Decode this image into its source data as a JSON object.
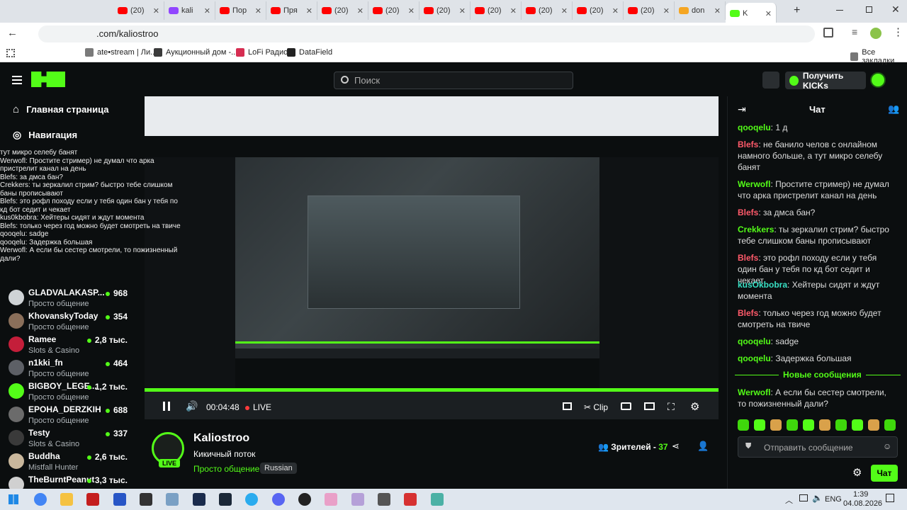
{
  "browser": {
    "tabs": [
      {
        "label": "(20)",
        "color": "#ff0000"
      },
      {
        "label": "kali",
        "color": "#9146ff"
      },
      {
        "label": "Пор",
        "color": "#ff0000"
      },
      {
        "label": "Пря",
        "color": "#ff0000"
      },
      {
        "label": "(20)",
        "color": "#ff0000"
      },
      {
        "label": "(20)",
        "color": "#ff0000"
      },
      {
        "label": "(20)",
        "color": "#ff0000"
      },
      {
        "label": "(20)",
        "color": "#ff0000"
      },
      {
        "label": "(20)",
        "color": "#ff0000"
      },
      {
        "label": "(20)",
        "color": "#ff0000"
      },
      {
        "label": "(20)",
        "color": "#ff0000"
      },
      {
        "label": "don",
        "color": "#f5a623"
      },
      {
        "label": "K",
        "color": "#53fc18"
      }
    ],
    "new_tab": "+",
    "url": ".com/kaliostroo",
    "bookmarks": [
      {
        "label": "ate•stream | Ли...",
        "color": "#7a7a7a"
      },
      {
        "label": "Аукционный дом -...",
        "color": "#3b3b3b"
      },
      {
        "label": "LoFi Радио",
        "color": "#d62d51"
      },
      {
        "label": "DataField",
        "color": "#222"
      }
    ],
    "all_bookmarks": "Все закладки"
  },
  "header": {
    "search_placeholder": "Поиск",
    "get_kicks": "Получить KICKs"
  },
  "sidebar": {
    "nav": [
      {
        "label": "Главная страница",
        "icon": "home-icon"
      },
      {
        "label": "Навигация",
        "icon": "compass-icon"
      }
    ],
    "channels": [
      {
        "name": "GLADVALAKASP...",
        "category": "Просто общение",
        "viewers": "968",
        "avatar": "#cfd3d6"
      },
      {
        "name": "KhovanskyToday",
        "category": "Просто общение",
        "viewers": "354",
        "avatar": "#8a6f5a"
      },
      {
        "name": "Ramee",
        "category": "Slots & Casino",
        "viewers": "2,8 тыс.",
        "avatar": "#c41e3a"
      },
      {
        "name": "n1kki_fn",
        "category": "Просто общение",
        "viewers": "464",
        "avatar": "#5d6066"
      },
      {
        "name": "BIGBOY_LEGE...",
        "category": "Просто общение",
        "viewers": "1,2 тыс.",
        "avatar": "#53fc18"
      },
      {
        "name": "EPOHA_DERZKIH",
        "category": "Просто общение",
        "viewers": "688",
        "avatar": "#6b6b6b"
      },
      {
        "name": "Testy",
        "category": "Slots & Casino",
        "viewers": "337",
        "avatar": "#3a3a3a"
      },
      {
        "name": "Buddha",
        "category": "Mistfall Hunter",
        "viewers": "2,6 тыс.",
        "avatar": "#c9b79c"
      },
      {
        "name": "TheBurntPeanut",
        "category": "",
        "viewers": "3,3 тыс.",
        "avatar": "#d0d0d0"
      }
    ]
  },
  "ghost_overlay": [
    "тут микро селебу банят",
    "Werwofl: Простите стример) не думал что арка",
    "пристрелит канал на день",
    "Blefs: за дмса бан?",
    "Crekkers: ты зеркалил стрим? быстро тебе слишком",
    "баны прописывают",
    "Blefs: это рофл походу если у тебя один бан у тебя по",
    "кд бот седит и чекает",
    "kus0kbobra: Хейтеры сидят и ждут момента",
    "Blefs: только через год можно будет смотреть на твиче",
    "qooqelu: sadge",
    "qooqelu: Задержка большая",
    "Werwofl: А если бы сестер смотрели, то пожизненный",
    "дали?"
  ],
  "player": {
    "time": "00:04:48",
    "live": "LIVE",
    "clip": "Clip"
  },
  "stream": {
    "streamer": "Kaliostroo",
    "title": "Кикичный поток",
    "category": "Просто общение",
    "tag": "Russian",
    "live_badge": "LIVE",
    "viewers_label": "Зрителей - ",
    "viewers_count": "37"
  },
  "chat": {
    "title": "Чат",
    "messages": [
      {
        "user": "qooqelu",
        "text": "1 д",
        "color": "#53fc18"
      },
      {
        "user": "Blefs",
        "text": "не банило челов с онлайном намного больше, а тут микро селебу банят",
        "color": "#ff5a6a"
      },
      {
        "user": "Werwofl",
        "text": "Простите стример) не думал что арка пристрелит канал на день",
        "color": "#53fc18"
      },
      {
        "user": "Blefs",
        "text": "за дмса бан?",
        "color": "#ff5a6a"
      },
      {
        "user": "Crekkers",
        "text": "ты зеркалил стрим? быстро тебе слишком баны прописывают",
        "color": "#53fc18"
      },
      {
        "user": "Blefs",
        "text": "это рофл походу если у тебя один бан у тебя по кд бот седит и чекает",
        "color": "#ff5a6a"
      },
      {
        "user": "kusOkbobra",
        "text": "Хейтеры сидят и ждут момента",
        "color": "#38e0c4"
      },
      {
        "user": "Blefs",
        "text": "только через год можно будет смотреть на твиче",
        "color": "#ff5a6a"
      },
      {
        "user": "qooqelu",
        "text": "sadge",
        "color": "#53fc18"
      },
      {
        "user": "qooqelu",
        "text": "Задержка большая",
        "color": "#53fc18"
      }
    ],
    "new_messages": "Новые сообщения",
    "last": {
      "user": "Werwofl",
      "text": "А если бы сестер смотрели, то пожизненный дали?",
      "color": "#53fc18"
    },
    "input_placeholder": "Отправить сообщение",
    "send": "Чат"
  },
  "taskbar": {
    "lang": "ENG",
    "time": "1:39",
    "date": "04.08.2026"
  },
  "colors": {
    "accent": "#53fc18",
    "bg": "#0b0e0f"
  }
}
